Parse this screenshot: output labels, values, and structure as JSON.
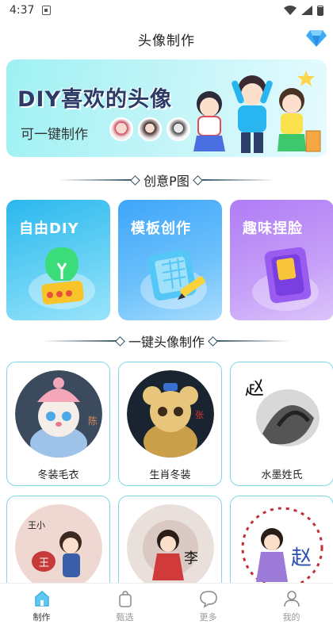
{
  "status_bar": {
    "time": "4:37"
  },
  "header": {
    "title": "头像制作",
    "diamond_icon": "diamond-icon"
  },
  "banner": {
    "headline": "DIY喜欢的头像",
    "subtitle": "可一键制作"
  },
  "creative_section": {
    "title": "创意P图",
    "cards": [
      {
        "label": "自由DIY",
        "icon": "lightbulb-icon"
      },
      {
        "label": "模板创作",
        "icon": "template-pencil-icon"
      },
      {
        "label": "趣味捏脸",
        "icon": "phone-card-icon"
      }
    ]
  },
  "avatar_section": {
    "title": "一键头像制作",
    "items": [
      {
        "caption": "冬装毛衣"
      },
      {
        "caption": "生肖冬装"
      },
      {
        "caption": "水墨姓氏"
      },
      {
        "caption": ""
      },
      {
        "caption": ""
      },
      {
        "caption": ""
      }
    ]
  },
  "tabs": [
    {
      "label": "制作",
      "active": true,
      "icon": "home-icon"
    },
    {
      "label": "甄选",
      "active": false,
      "icon": "bag-icon"
    },
    {
      "label": "更多",
      "active": false,
      "icon": "chat-bubble-icon"
    },
    {
      "label": "我的",
      "active": false,
      "icon": "user-icon"
    }
  ],
  "colors": {
    "accent": "#29b6e6",
    "card_border": "#7fd7e6",
    "tab_active": "#3bb0e0"
  }
}
